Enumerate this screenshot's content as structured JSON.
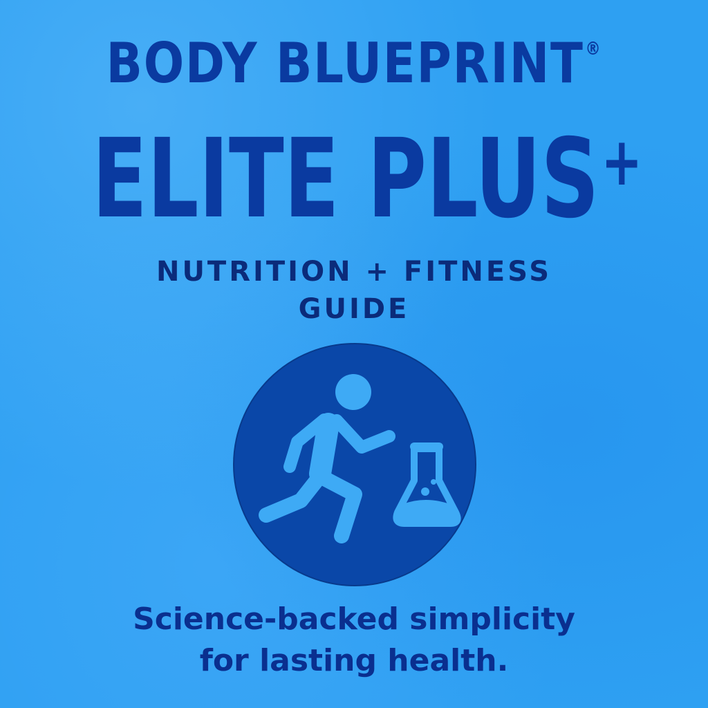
{
  "brand": {
    "name": "BODY BLUEPRINT",
    "registered_mark": "®"
  },
  "product": {
    "name": "ELITE PLUS",
    "plus_mark": "+"
  },
  "subtitle": {
    "line1": "NUTRITION + FITNESS",
    "line2": "GUIDE"
  },
  "emblem": {
    "icons": [
      "running-person-icon",
      "flask-icon"
    ]
  },
  "tagline": {
    "line1": "Science-backed simplicity",
    "line2": "for lasting health."
  },
  "colors": {
    "background": "#2ea0f2",
    "primary_text": "#0a3aa0",
    "emblem_circle": "#0a47a8",
    "emblem_icons": "#3eaaf5"
  }
}
